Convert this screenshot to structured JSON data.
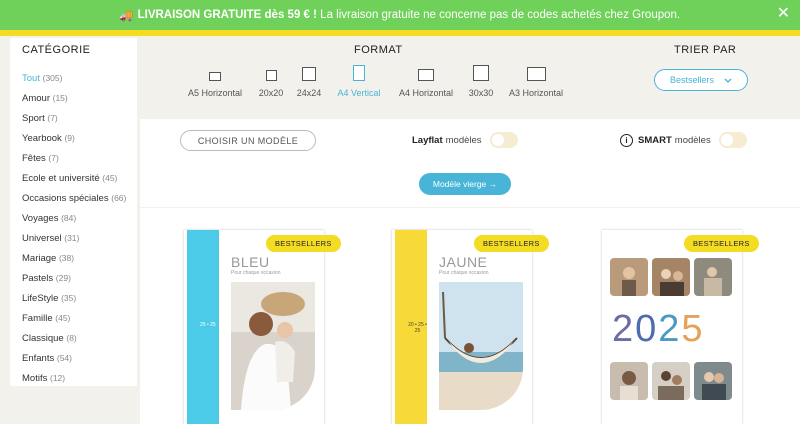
{
  "banner": {
    "icon": "truck-icon",
    "bold_text": "LIVRAISON GRATUITE dès 59 € !",
    "text": "La livraison gratuite ne concerne pas de codes achetés chez Groupon.",
    "close": "✕"
  },
  "sidebar": {
    "title": "CATÉGORIE",
    "items": [
      {
        "label": "Tout",
        "count": "(305)"
      },
      {
        "label": "Amour",
        "count": "(15)"
      },
      {
        "label": "Sport",
        "count": "(7)"
      },
      {
        "label": "Yearbook",
        "count": "(9)"
      },
      {
        "label": "Fêtes",
        "count": "(7)"
      },
      {
        "label": "Ecole et université",
        "count": "(45)"
      },
      {
        "label": "Occasions spéciales",
        "count": "(66)"
      },
      {
        "label": "Voyages",
        "count": "(84)"
      },
      {
        "label": "Universel",
        "count": "(31)"
      },
      {
        "label": "Mariage",
        "count": "(38)"
      },
      {
        "label": "Pastels",
        "count": "(29)"
      },
      {
        "label": "LifeStyle",
        "count": "(35)"
      },
      {
        "label": "Famille",
        "count": "(45)"
      },
      {
        "label": "Classique",
        "count": "(8)"
      },
      {
        "label": "Enfants",
        "count": "(54)"
      },
      {
        "label": "Motifs",
        "count": "(12)"
      }
    ]
  },
  "format": {
    "title": "FORMAT",
    "items": [
      {
        "label": "A5 Horizontal"
      },
      {
        "label": "20x20"
      },
      {
        "label": "24x24"
      },
      {
        "label": "A4 Vertical"
      },
      {
        "label": "A4 Horizontal"
      },
      {
        "label": "30x30"
      },
      {
        "label": "A3 Horizontal"
      }
    ]
  },
  "sort": {
    "title": "TRIER PAR",
    "value": "Bestsellers",
    "chevron": "⌄"
  },
  "options": {
    "choose_label": "CHOISIR UN MODÈLE",
    "layflat_bold": "Layflat",
    "layflat_text": "modèles",
    "smart_bold": "SMART",
    "smart_text": "modèles",
    "info_glyph": "i",
    "blank_label": "Modèle vierge →"
  },
  "products": [
    {
      "badge": "BESTSELLERS",
      "title": "BLEU",
      "subtitle": "Pour chaque occasion",
      "spine_text": "25 • 25"
    },
    {
      "badge": "BESTSELLERS",
      "title": "JAUNE",
      "subtitle": "Pour chaque occasion",
      "spine_text": "20 • 25 • 25"
    },
    {
      "badge": "BESTSELLERS",
      "year": [
        "2",
        "0",
        "2",
        "5"
      ]
    }
  ],
  "colors": {
    "banner": "#6fd05a",
    "accent": "#48b5d8",
    "badge": "#f3dc22",
    "spine_blue": "#4ccbe8",
    "spine_yellow": "#f7d938"
  }
}
